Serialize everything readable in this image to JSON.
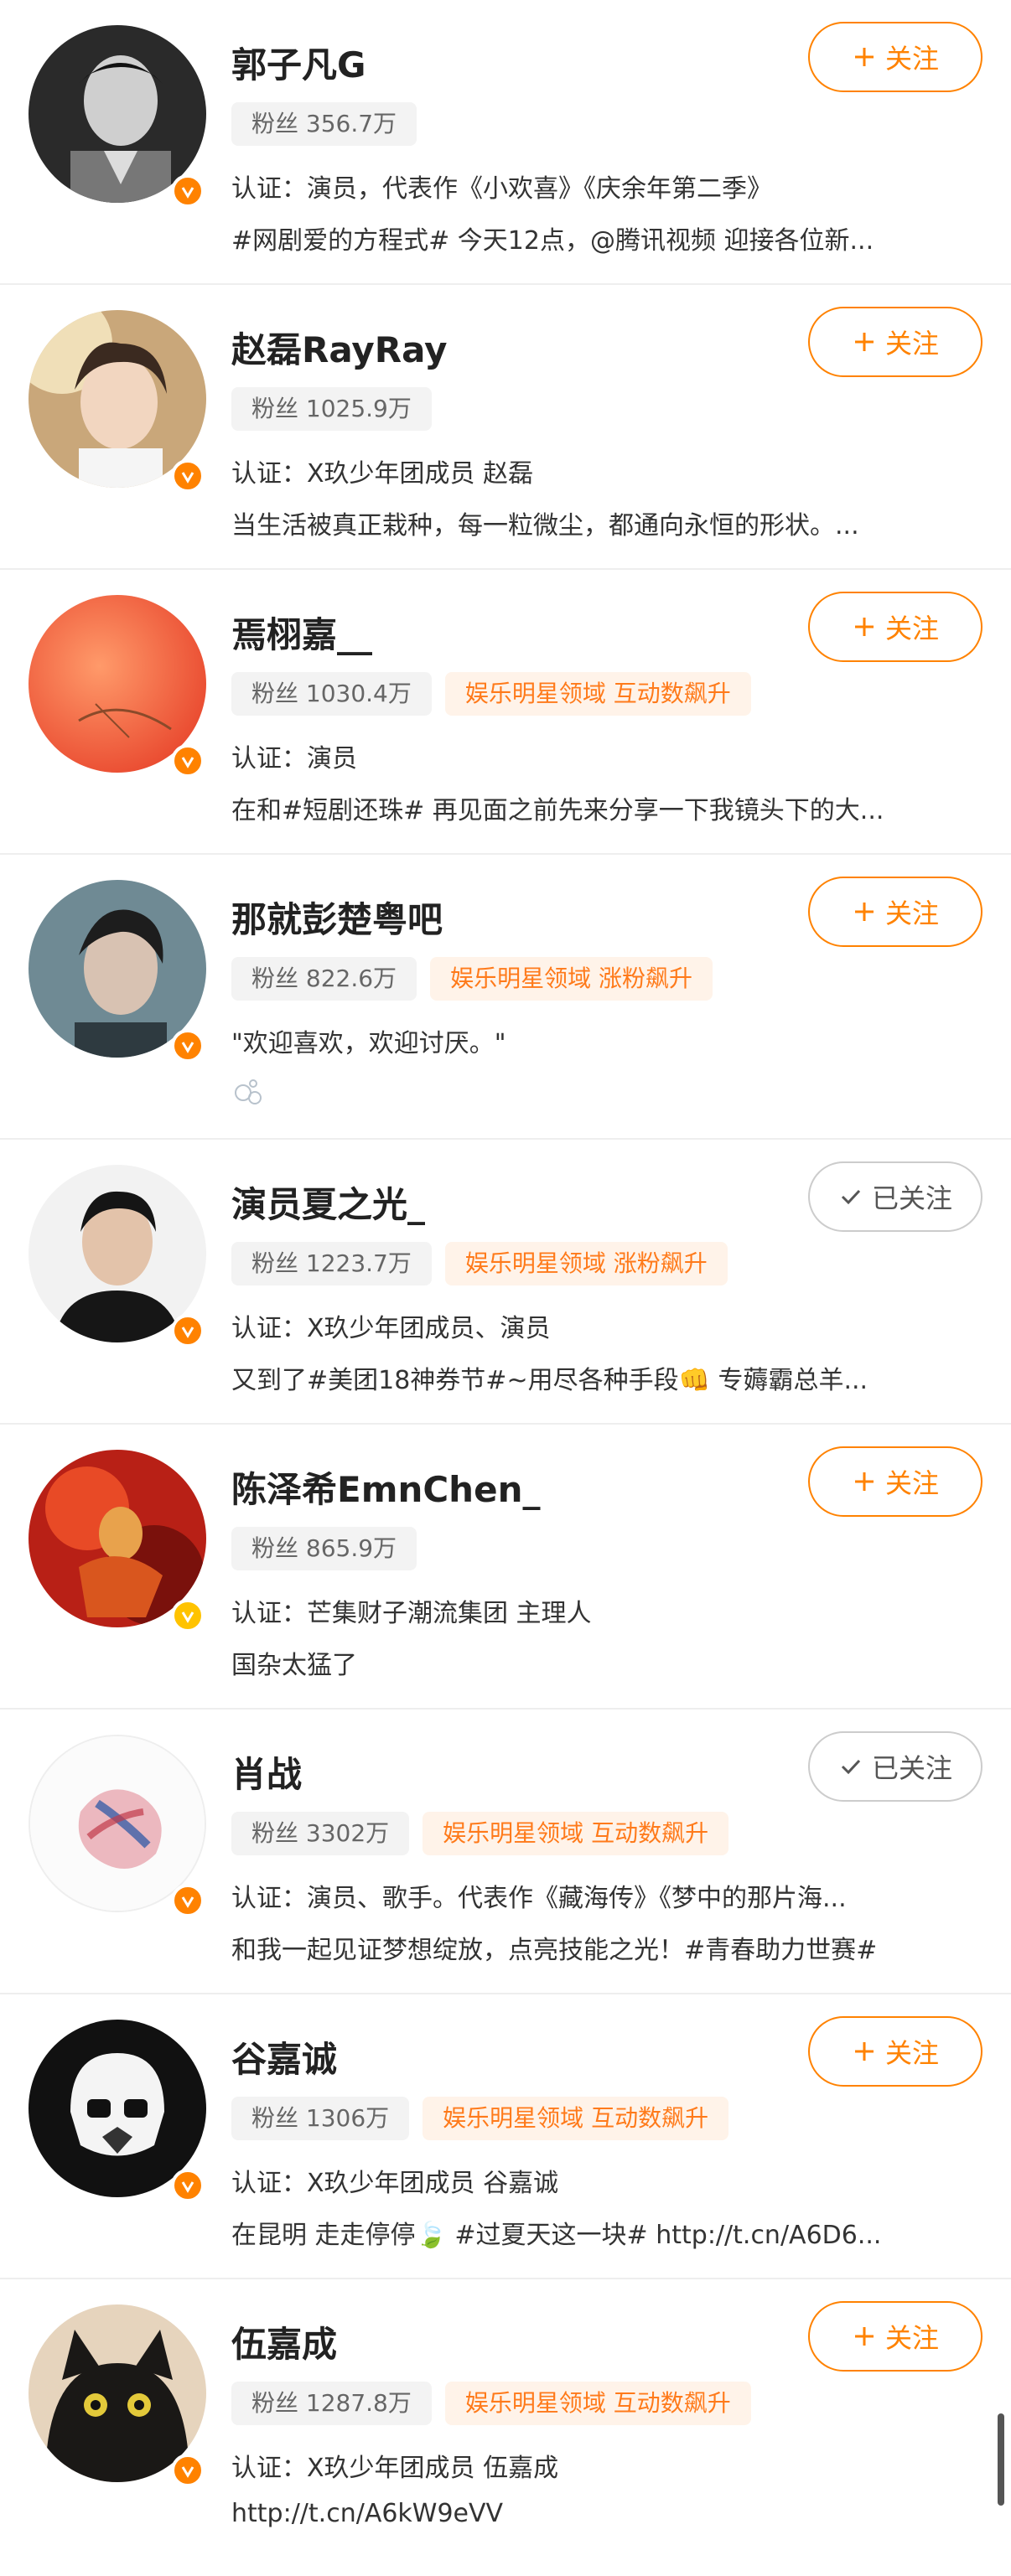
{
  "users": [
    {
      "name": "郭子凡G",
      "fans": "粉丝 356.7万",
      "trend": "",
      "verify": "认证：演员，代表作《小欢喜》《庆余年第二季》",
      "desc": "#网剧爱的方程式# 今天12点，@腾讯视频 迎接各位新...",
      "button": "关注",
      "followed": false
    },
    {
      "name": "赵磊RayRay",
      "fans": "粉丝 1025.9万",
      "trend": "",
      "verify": "认证：X玖少年团成员 赵磊",
      "desc": "当生活被真正栽种，每一粒微尘，都通向永恒的形状。...",
      "button": "关注",
      "followed": false
    },
    {
      "name": "焉栩嘉__",
      "fans": "粉丝 1030.4万",
      "trend": "娱乐明星领域 互动数飙升",
      "verify": "认证：演员",
      "desc": "在和#短剧还珠# 再见面之前先来分享一下我镜头下的大...",
      "button": "关注",
      "followed": false
    },
    {
      "name": "那就彭楚粤吧",
      "fans": "粉丝 822.6万",
      "trend": "娱乐明星领域 涨粉飙升",
      "verify": "\"欢迎喜欢，欢迎讨厌。\"",
      "desc": "",
      "button": "关注",
      "followed": false
    },
    {
      "name": "演员夏之光_",
      "fans": "粉丝 1223.7万",
      "trend": "娱乐明星领域 涨粉飙升",
      "verify": "认证：X玖少年团成员、演员",
      "desc": "又到了#美团18神券节#~用尽各种手段👊 专薅霸总羊...",
      "button": "已关注",
      "followed": true
    },
    {
      "name": "陈泽希EmnChen_",
      "fans": "粉丝 865.9万",
      "trend": "",
      "verify": "认证：芒集财子潮流集团 主理人",
      "desc": "国杂太猛了",
      "button": "关注",
      "followed": false
    },
    {
      "name": "肖战",
      "fans": "粉丝 3302万",
      "trend": "娱乐明星领域 互动数飙升",
      "verify": "认证：演员、歌手。代表作《藏海传》《梦中的那片海...",
      "desc": "和我一起见证梦想绽放，点亮技能之光！#青春助力世赛#",
      "button": "已关注",
      "followed": true
    },
    {
      "name": "谷嘉诚",
      "fans": "粉丝 1306万",
      "trend": "娱乐明星领域 互动数飙升",
      "verify": "认证：X玖少年团成员 谷嘉诚",
      "desc": "在昆明 走走停停🍃 #过夏天这一块# http://t.cn/A6D6...",
      "button": "关注",
      "followed": false
    },
    {
      "name": "伍嘉成",
      "fans": "粉丝 1287.8万",
      "trend": "娱乐明星领域 互动数飙升",
      "verify": "认证：X玖少年团成员 伍嘉成",
      "desc": "http://t.cn/A6kW9eVV",
      "button": "关注",
      "followed": false
    }
  ],
  "colors": {
    "accent": "#ff8200",
    "trend_text": "#ff7a1a",
    "trend_bg": "#fff3e9",
    "fans_bg": "#f3f3f3",
    "gold_badge": "#ffc300"
  }
}
